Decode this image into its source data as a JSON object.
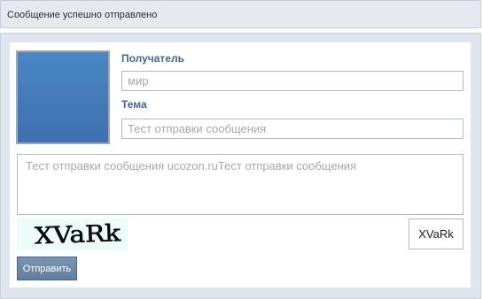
{
  "status": {
    "message": "Сообщение успешно отправлено"
  },
  "form": {
    "recipient_label": "Получатель",
    "recipient_placeholder": "мир",
    "subject_label": "Тема",
    "subject_placeholder": "Тест отправки сообщения",
    "message_placeholder": "Тест отправки сообщения ucozon.ruТест отправки сообщения",
    "captcha_image_text": "XVaRk",
    "captcha_value": "XVaRk",
    "submit_label": "Отправить"
  },
  "colors": {
    "status_bar_bg": "#e6eaef",
    "panel_bg": "#dfe5ec",
    "label_color": "#45658b",
    "avatar_color": "#4a87c4",
    "captcha_bg": "#ecfcfb",
    "button_bg": "#6c88a8"
  }
}
